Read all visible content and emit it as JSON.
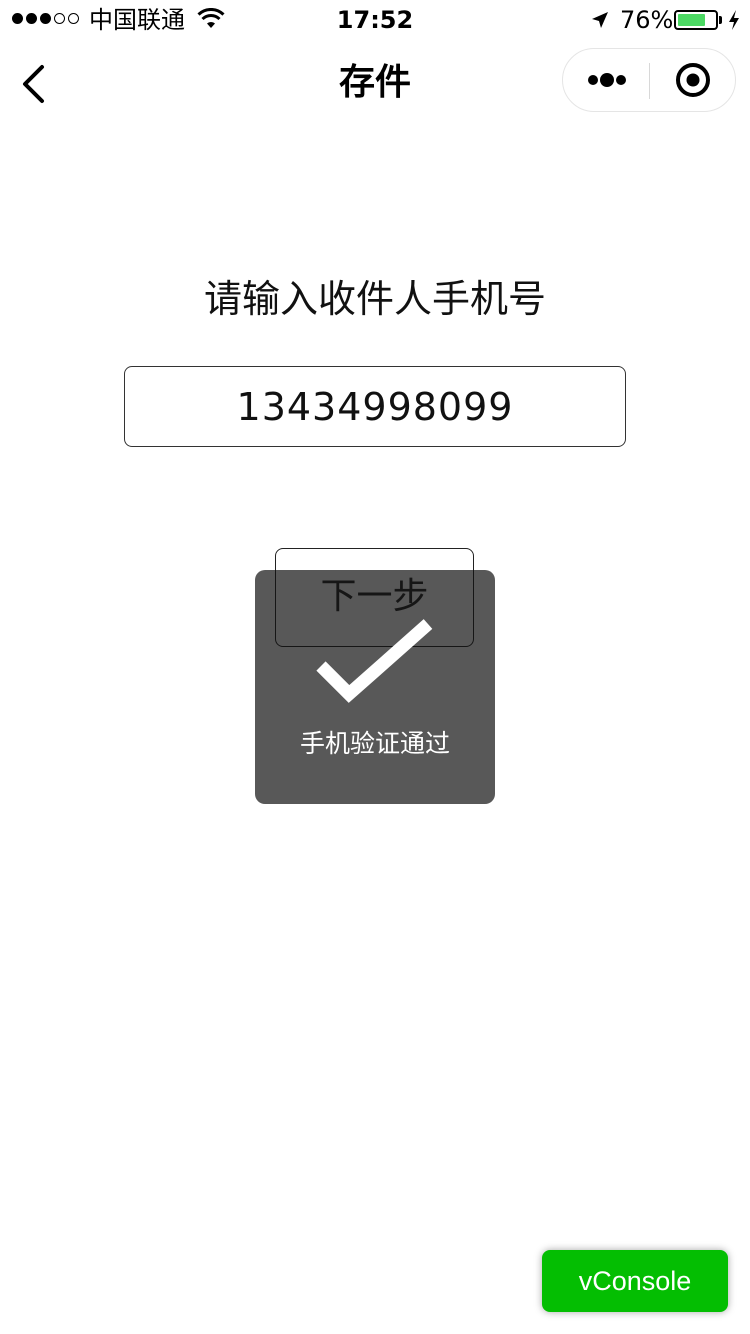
{
  "status_bar": {
    "signal_dots": [
      true,
      true,
      true,
      false,
      false
    ],
    "carrier": "中国联通",
    "wifi_icon": "wifi-icon",
    "time": "17:52",
    "location_icon": "location-arrow-icon",
    "battery_percent_text": "76%",
    "battery_level": 0.76,
    "battery_color": "#4cd964",
    "charging_icon": "bolt-icon"
  },
  "nav": {
    "back_icon": "chevron-left-icon",
    "title": "存件",
    "more_icon": "more-dots-icon",
    "close_icon": "target-circle-icon"
  },
  "form": {
    "prompt": "请输入收件人手机号",
    "phone_value": "13434998099",
    "next_label": "下一步"
  },
  "toast": {
    "icon": "checkmark-icon",
    "message": "手机验证通过"
  },
  "vconsole": {
    "label": "vConsole",
    "color": "#04be02"
  }
}
